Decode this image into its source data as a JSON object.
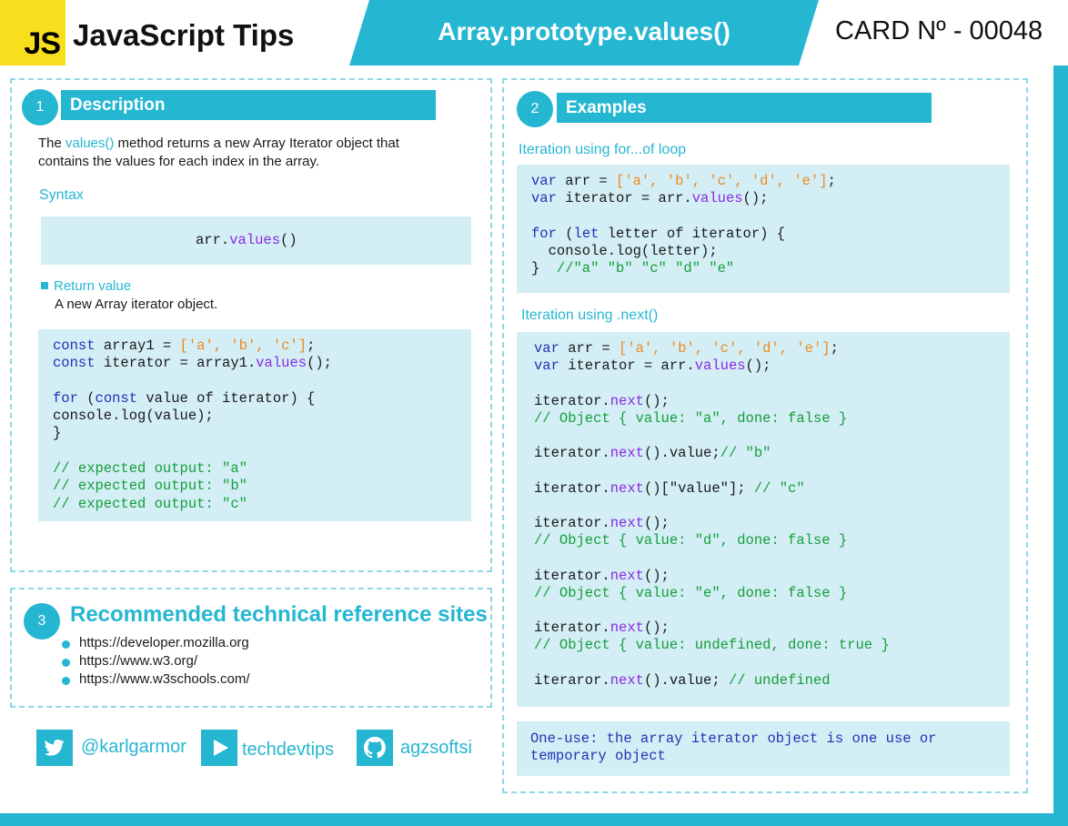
{
  "header": {
    "logo_text": "JS",
    "brand_title": "JavaScript Tips",
    "banner_title": "Array.prototype.values()",
    "card_number": "CARD Nº - 00048"
  },
  "description": {
    "number": "1",
    "title": "Description",
    "intro_pre": "The ",
    "intro_method": "values()",
    "intro_post": " method returns a new Array Iterator object that",
    "intro_line2": "contains the values for each index in the array.",
    "syntax_heading": "Syntax",
    "syntax_obj": "arr.",
    "syntax_method": "values",
    "syntax_parens": "()",
    "return_heading": "Return value",
    "return_text": "A  new Array iterator object."
  },
  "sites": {
    "number": "3",
    "title": "Recommended technical reference sites",
    "items": [
      "https://developer.mozilla.org",
      "https://www.w3.org/",
      "https://www.w3schools.com/"
    ]
  },
  "social": {
    "twitter": "@karlgarmor",
    "youtube": "techdevtips",
    "github": "agzsoftsi"
  },
  "examples": {
    "number": "2",
    "title": "Examples",
    "heading_forof": "Iteration using for...of loop",
    "heading_next": "Iteration using .next()",
    "note_line1": "One-use: the array iterator object is one use or",
    "note_line2": "temporary object"
  },
  "colors": {
    "accent": "#25b6d2",
    "code_bg": "#d3eef5",
    "js_yellow": "#f7df1e",
    "keyword": "#1f33b5",
    "method": "#8a2be2",
    "string": "#ef8a1f",
    "comment": "#169e3a"
  }
}
